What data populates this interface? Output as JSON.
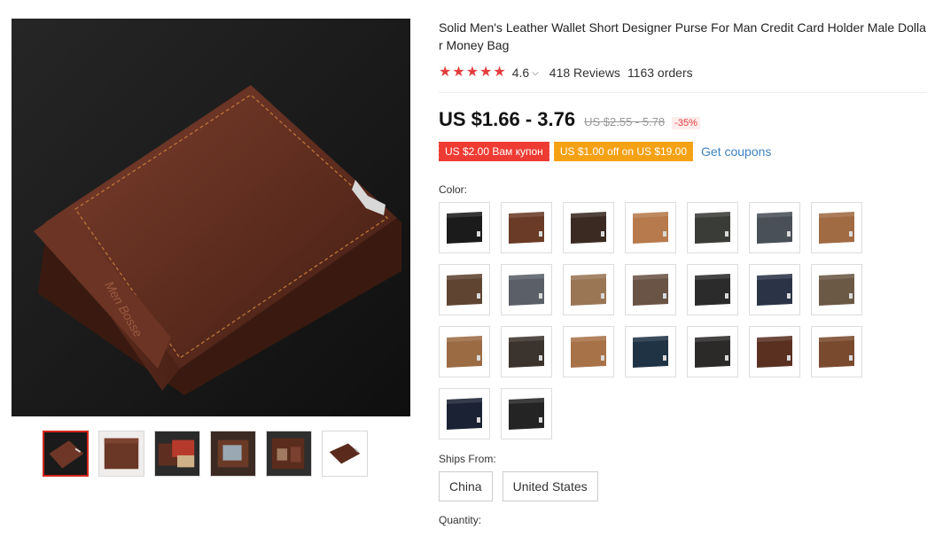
{
  "product": {
    "title": "Solid Men's Leather Wallet Short Designer Purse For Man Credit Card Holder Male Dollar Money Bag",
    "rating": "4.6",
    "reviews": "418 Reviews",
    "orders": "1163 orders",
    "price": "US $1.66 - 3.76",
    "old_price": "US $2.55 - 5.78",
    "discount": "-35%"
  },
  "coupons": {
    "first": "US $2.00 Вам купон",
    "second": "US $1.00 off on US $19.00",
    "get_label": "Get coupons"
  },
  "color": {
    "label": "Color:",
    "swatches": [
      "#1b1b1b",
      "#6a3b26",
      "#3a2a22",
      "#b77a4c",
      "#3a3c38",
      "#4a5058",
      "#a06a43",
      "#5e4431",
      "#5b6068",
      "#9a7655",
      "#6a5446",
      "#2b2b2b",
      "#2a3446",
      "#6b5845",
      "#9b6b44",
      "#3b332d",
      "#a87248",
      "#1f3345",
      "#2c2a29",
      "#5a3021",
      "#7a4a2e",
      "#1b2233",
      "#242424"
    ]
  },
  "ships": {
    "label": "Ships From:",
    "options": [
      "China",
      "United States"
    ]
  },
  "quantity": {
    "label": "Quantity:"
  },
  "colors": {
    "accent_red": "#e43d3d",
    "coupon_red": "#ee3b33",
    "coupon_orange": "#f5a114",
    "link_blue": "#3e83c5"
  },
  "gallery": {
    "thumb_count": 6,
    "active_thumb": 0
  }
}
